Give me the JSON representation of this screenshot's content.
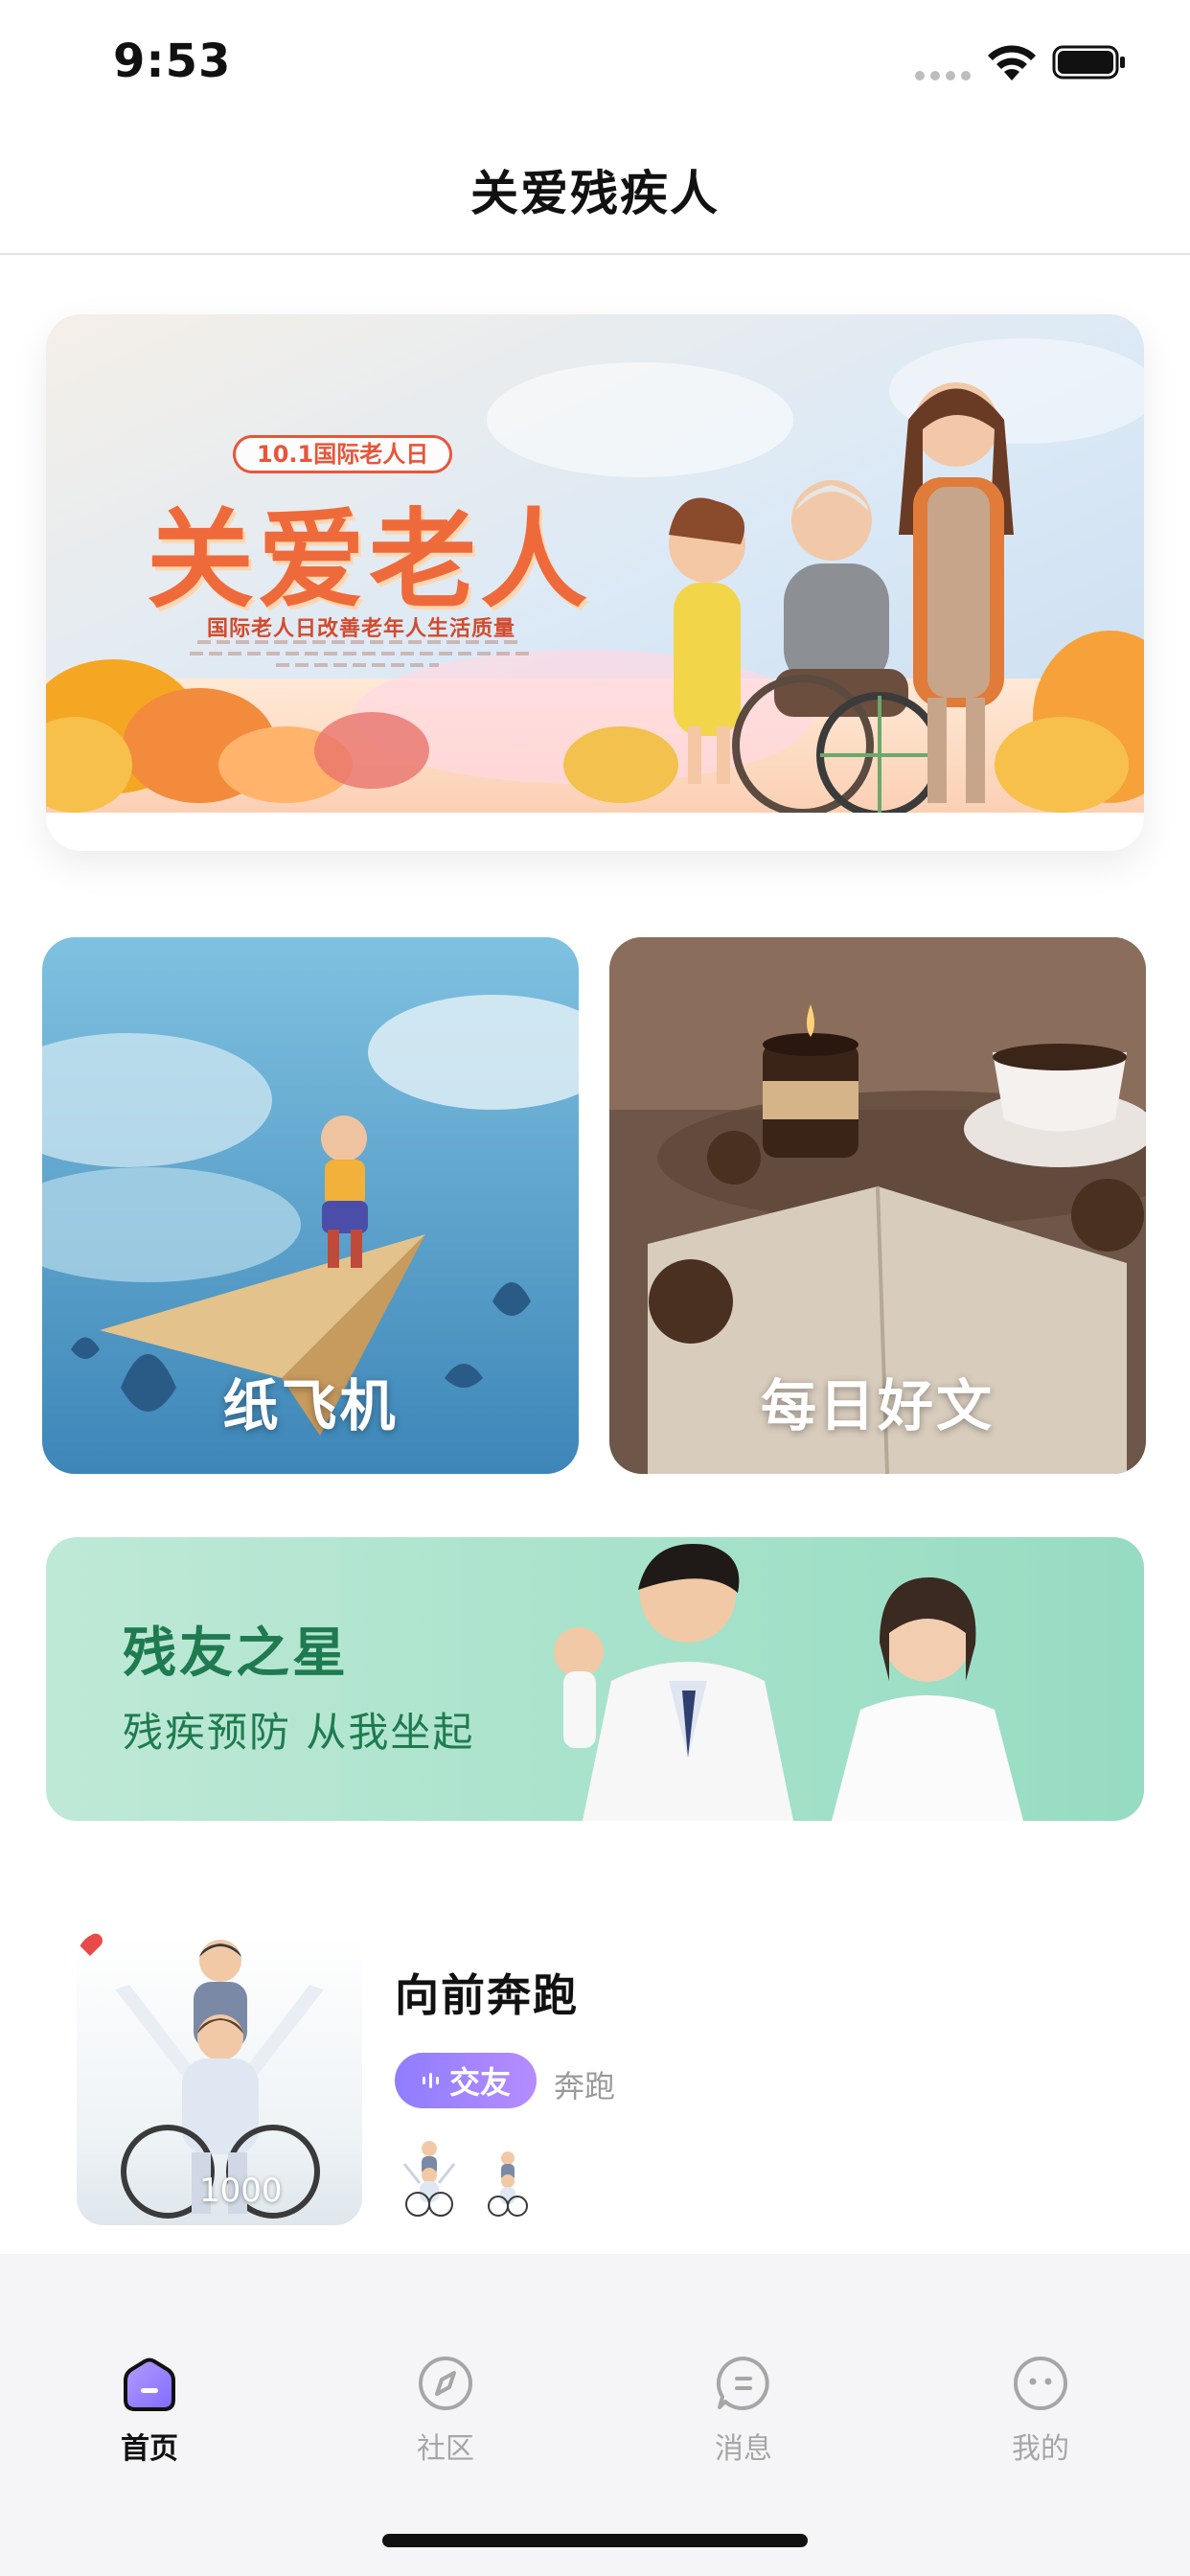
{
  "status_bar": {
    "time": "9:53"
  },
  "header": {
    "title": "关爱残疾人"
  },
  "hero_banner": {
    "badge": "10.1国际老人日",
    "title": "关爱老人",
    "subtitle": "国际老人日改善老年人生活质量"
  },
  "feature_cards": [
    {
      "label": "纸飞机"
    },
    {
      "label": "每日好文"
    }
  ],
  "promo_banner": {
    "title": "残友之星",
    "subtitle": "残疾预防  从我坐起"
  },
  "content_item": {
    "title": "向前奔跑",
    "tag": "交友",
    "category": "奔跑",
    "likes": "1000"
  },
  "tab_bar": {
    "active": "home",
    "tabs": [
      {
        "key": "home",
        "label": "首页",
        "icon": "home-icon"
      },
      {
        "key": "community",
        "label": "社区",
        "icon": "compass-icon"
      },
      {
        "key": "messages",
        "label": "消息",
        "icon": "message-icon"
      },
      {
        "key": "profile",
        "label": "我的",
        "icon": "smiley-icon"
      }
    ]
  },
  "colors": {
    "accent_purple": "#8f7dff",
    "promo_green": "#1f7b4f",
    "hero_orange": "#ef6a3a",
    "tabbar_bg": "#f5f5f7"
  }
}
